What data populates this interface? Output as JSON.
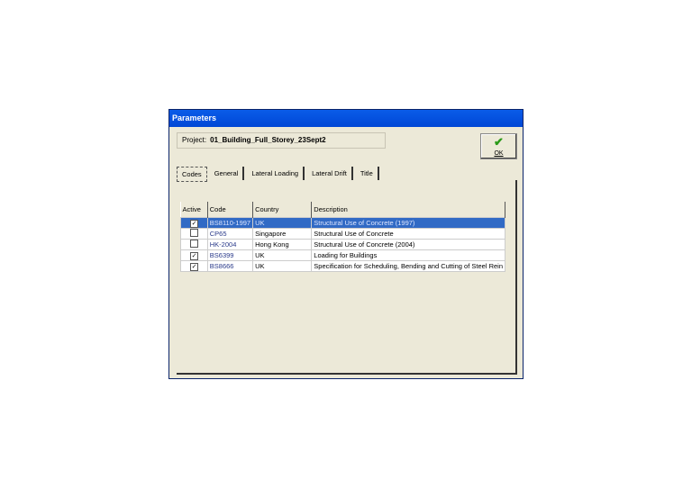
{
  "window": {
    "title": "Parameters"
  },
  "project": {
    "label": "Project:",
    "value": "01_Building_Full_Storey_23Sept2"
  },
  "ok_button": {
    "label": "OK"
  },
  "tabs": [
    "Codes",
    "General",
    "Lateral Loading",
    "Lateral Drift",
    "Title"
  ],
  "table": {
    "headers": [
      "Active",
      "Code",
      "Country",
      "Description"
    ],
    "rows": [
      {
        "active": true,
        "code": "BS8110-1997",
        "country": "UK",
        "description": "Structural Use of Concrete (1997)"
      },
      {
        "active": false,
        "code": "CP65",
        "country": "Singapore",
        "description": "Structural Use of Concrete"
      },
      {
        "active": false,
        "code": "HK-2004",
        "country": "Hong Kong",
        "description": "Structural Use of Concrete (2004)"
      },
      {
        "active": true,
        "code": "BS6399",
        "country": "UK",
        "description": "Loading for Buildings"
      },
      {
        "active": true,
        "code": "BS8666",
        "country": "UK",
        "description": "Specification for Scheduling, Bending and Cutting of Steel Rein"
      }
    ]
  }
}
